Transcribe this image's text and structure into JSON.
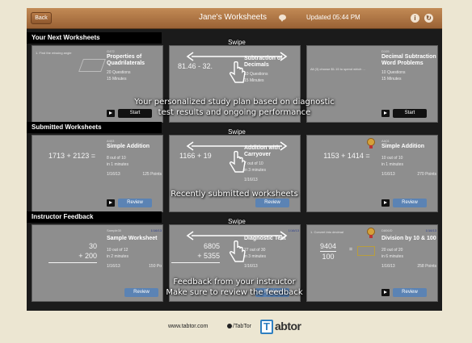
{
  "topbar": {
    "back_label": "Back",
    "title": "Jane's Worksheets",
    "updated": "Updated 05:44 PM",
    "icons": [
      "chat-icon",
      "info-icon",
      "refresh-icon"
    ]
  },
  "sections": [
    {
      "header": "Your Next Worksheets",
      "overlay": [
        "Your personalized study plan based on diagnostic",
        "test results and ongoing performance"
      ],
      "cards": [
        {
          "problem": "1. Find the missing angle",
          "code": "G472",
          "name": "Properties of Quadrilaterals",
          "line1": "20 Questions",
          "line2": "15 Minutes",
          "date": "",
          "points": "",
          "action": "Start"
        },
        {
          "problem": "81.46 - 32.",
          "code": "",
          "name": "Subtraction of Decimals",
          "line1": "10 Questions",
          "line2": "15 Minutes",
          "date": "",
          "points": "",
          "action": "Start"
        },
        {
          "problem": "Ali (3) choose $1.15 to spend which ...",
          "code": "D105",
          "name": "Decimal Subtraction Word Problems",
          "line1": "10 Questions",
          "line2": "15 Minutes",
          "date": "",
          "points": "",
          "action": "Start"
        }
      ]
    },
    {
      "header": "Submitted Worksheets",
      "overlay": [
        "Recently submitted worksheets"
      ],
      "cards": [
        {
          "problem": "1713 + 2123 =",
          "code": "A403",
          "name": "Simple Addition",
          "line1": "8 out of 10",
          "line2": "in 1 minutes",
          "date": "1/16/13",
          "points": "125 Points",
          "action": "Review"
        },
        {
          "problem": "1166 + 19",
          "code": "",
          "name": "Addition with Carryover",
          "line1": "7 out of 10",
          "line2": "in 3 minutes",
          "date": "1/16/13",
          "points": "",
          "action": "Review"
        },
        {
          "problem": "1153 + 1414 =",
          "code": "AA01",
          "name": "Simple Addition",
          "line1": "10 out of 10",
          "line2": "in 1 minutes",
          "date": "1/16/13",
          "points": "270 Points",
          "action": "Review"
        }
      ]
    },
    {
      "header": "Instructor Feedback",
      "overlay": [
        "Feedback from your instructor",
        "Make sure to review the feedback"
      ],
      "cards": [
        {
          "problem_top": "30",
          "problem_bottom": "+ 200",
          "code": "Sample30",
          "date_top": "1/16/13",
          "name": "Sample Worksheet",
          "line1": "10 out of 12",
          "line2": "in 2 minutes",
          "date": "1/16/13",
          "points": "150 Po",
          "action": "Review"
        },
        {
          "problem_top": "6805",
          "problem_bottom": "+ 5355",
          "code": "",
          "date_top": "1/16/13",
          "name": "Diagnostic Test",
          "line1": "27 out of 30",
          "line2": "in 3 minutes",
          "date": "1/16/13",
          "points": "",
          "action": "Review"
        },
        {
          "problem": "1. Convert into decimal",
          "num": "9404",
          "den": "100",
          "code": "D806/D",
          "date_top": "1/16/13",
          "name": "Division by 10 & 100",
          "line1": "20 out of 20",
          "line2": "in 6 minutes",
          "date": "1/16/13",
          "points": "258 Points",
          "action": "Review"
        }
      ]
    }
  ],
  "swipe_label": "Swipe",
  "footer": {
    "url": "www.tabtor.com",
    "facebook": "/TabTor",
    "logo_box": "T",
    "logo_rest": "abtor"
  }
}
